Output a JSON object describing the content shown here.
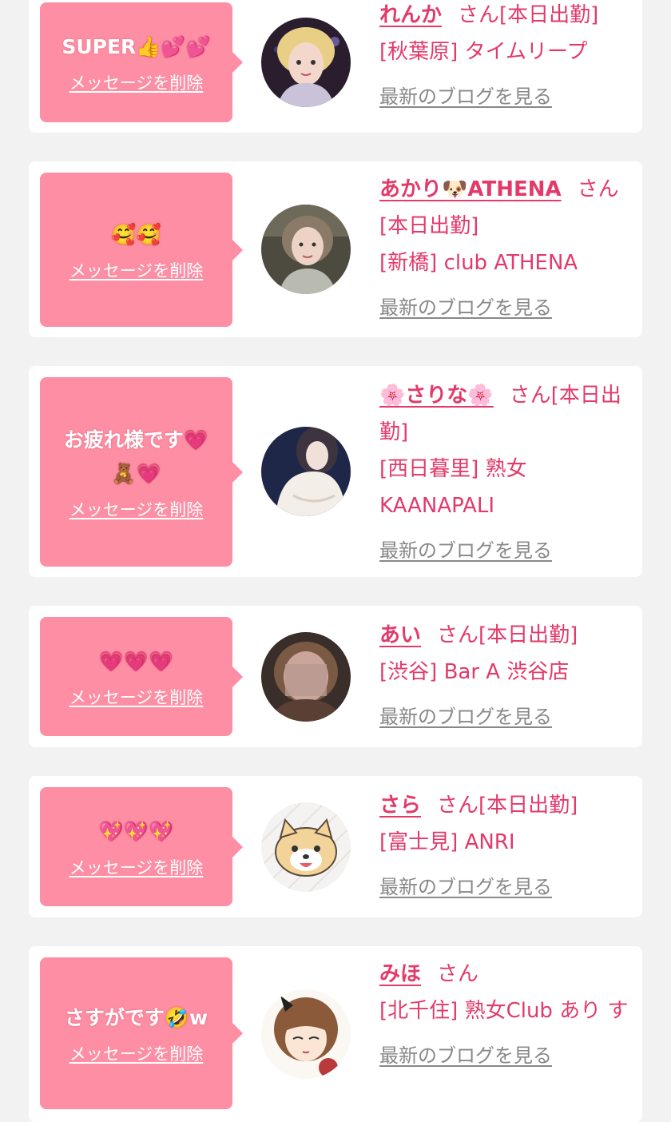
{
  "colors": {
    "background": "#f2f2f2",
    "card": "#ffffff",
    "bubble": "#fd8ea3",
    "accent": "#e33a6a",
    "link_gray": "#888888"
  },
  "labels": {
    "delete": "メッセージを削除",
    "blog": "最新のブログを見る",
    "san": "さん"
  },
  "cards": [
    {
      "message": "SUPER👍💕💕",
      "name": "れんか",
      "status": "[本日出勤]",
      "area": "[秋葉原]",
      "shop": "タイムリープ",
      "avatar_icon": "girl-photo-icon"
    },
    {
      "message": "🥰🥰",
      "name": "あかり🐶ATHENA",
      "status": "[本日出勤]",
      "area": "[新橋]",
      "shop": "club ATHENA",
      "avatar_icon": "girl-photo-icon"
    },
    {
      "message": "お疲れ様です💗🧸💗",
      "name": "🌸さりな🌸",
      "status": "[本日出勤]",
      "area": "[西日暮里]",
      "shop": "熟女KAANAPALI",
      "avatar_icon": "girl-photo-icon"
    },
    {
      "message": "💗💗💗",
      "name": "あい",
      "status": "[本日出勤]",
      "area": "[渋谷]",
      "shop": "Bar A 渋谷店",
      "avatar_icon": "blurred-photo-icon"
    },
    {
      "message": "💖💖💖",
      "name": "さら",
      "status": "[本日出勤]",
      "area": "[富士見]",
      "shop": "ANRI",
      "avatar_icon": "dog-illustration-icon"
    },
    {
      "message": "さすがです🤣w",
      "name": "みほ",
      "status": "",
      "area": "[北千住]",
      "shop": "熟女Club あり す",
      "avatar_icon": "girl-illustration-icon"
    }
  ]
}
